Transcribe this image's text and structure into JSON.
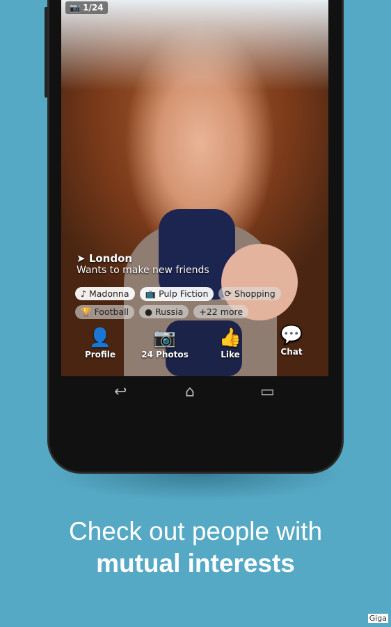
{
  "photo_counter": "1/24",
  "profile": {
    "city": "London",
    "status": "Wants to make new friends"
  },
  "interests": [
    {
      "label": "Madonna",
      "icon": "♪",
      "style": "white"
    },
    {
      "label": "Pulp Fiction",
      "icon": "📺",
      "style": "white"
    },
    {
      "label": "Shopping",
      "icon": "⟳",
      "style": "grey"
    },
    {
      "label": "Football",
      "icon": "🏆",
      "style": "grey"
    },
    {
      "label": "Russia",
      "icon": "●",
      "style": "grey"
    },
    {
      "label": "+22 more",
      "icon": "",
      "style": "grey"
    }
  ],
  "actions": {
    "profile": "Profile",
    "photos": "24 Photos",
    "like": "Like",
    "chat": "Chat"
  },
  "tagline": {
    "line1": "Check out people with",
    "line2": "mutual interests"
  },
  "watermark": "Giga",
  "colors": {
    "background": "#56a9c5",
    "chat_icon": "#2a8fd0"
  }
}
